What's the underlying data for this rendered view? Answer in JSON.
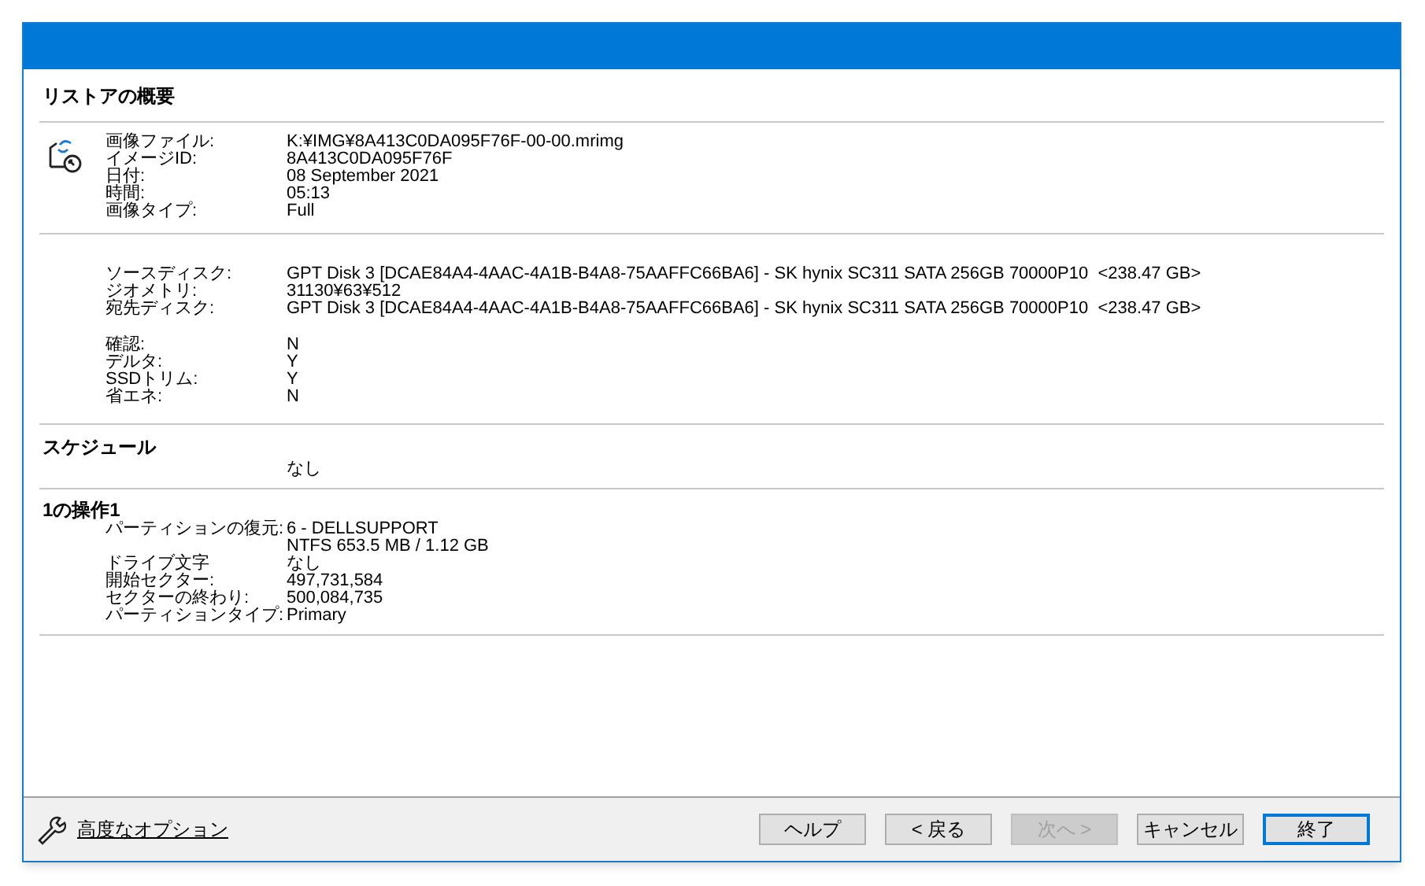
{
  "summary": {
    "title": "リストアの概要",
    "image_rows": [
      {
        "label": "画像ファイル:",
        "value": "K:¥IMG¥8A413C0DA095F76F-00-00.mrimg"
      },
      {
        "label": "イメージID:",
        "value": "8A413C0DA095F76F"
      },
      {
        "label": "日付:",
        "value": "08 September 2021"
      },
      {
        "label": "時間:",
        "value": "05:13"
      },
      {
        "label": "画像タイプ:",
        "value": "Full"
      }
    ],
    "disk_rows": [
      {
        "label": "ソースディスク:",
        "value": "GPT Disk 3 [DCAE84A4-4AAC-4A1B-B4A8-75AAFFC66BA6] - SK hynix SC311 SATA 256GB 70000P10  <238.47 GB>"
      },
      {
        "label": "ジオメトリ:",
        "value": "31130¥63¥512"
      },
      {
        "label": "宛先ディスク:",
        "value": "GPT Disk 3 [DCAE84A4-4AAC-4A1B-B4A8-75AAFFC66BA6] - SK hynix SC311 SATA 256GB 70000P10  <238.47 GB>"
      }
    ],
    "option_rows": [
      {
        "label": "確認:",
        "value": "N"
      },
      {
        "label": "デルタ:",
        "value": "Y"
      },
      {
        "label": "SSDトリム:",
        "value": "Y"
      },
      {
        "label": "省エネ:",
        "value": "N"
      }
    ]
  },
  "schedule": {
    "title": "スケジュール",
    "value": "なし"
  },
  "operation": {
    "title": "1の操作1",
    "rows": [
      {
        "label": "パーティションの復元:",
        "values": [
          "6 - DELLSUPPORT",
          "NTFS 653.5 MB / 1.12 GB"
        ]
      },
      {
        "label": "ドライブ文字",
        "values": [
          "なし"
        ]
      },
      {
        "label": "開始セクター:",
        "values": [
          "497,731,584"
        ]
      },
      {
        "label": "セクターの終わり:",
        "values": [
          "500,084,735"
        ]
      },
      {
        "label": "パーティションタイプ:",
        "values": [
          "Primary"
        ]
      }
    ]
  },
  "footer": {
    "advanced_link": "高度なオプション",
    "buttons": [
      {
        "label": "ヘルプ",
        "disabled": false,
        "default": false
      },
      {
        "label": "< 戻る",
        "disabled": false,
        "default": false
      },
      {
        "label": "次へ >",
        "disabled": true,
        "default": false
      },
      {
        "label": "キャンセル",
        "disabled": false,
        "default": false
      },
      {
        "label": "終了",
        "disabled": false,
        "default": true
      }
    ]
  }
}
